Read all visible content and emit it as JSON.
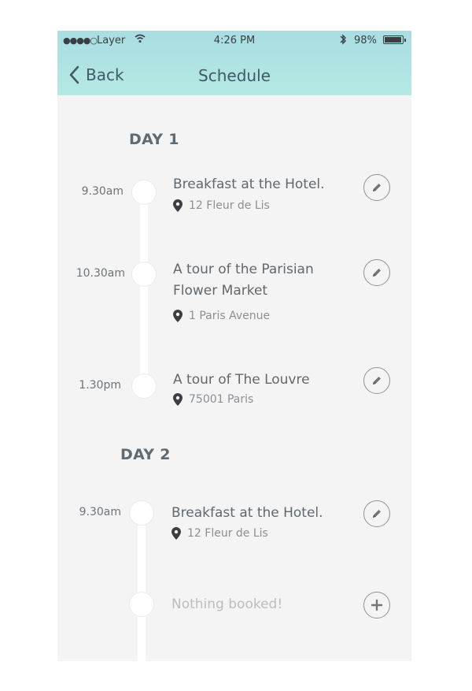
{
  "status_bar": {
    "carrier": "Layer",
    "time": "4:26 PM",
    "battery": "98%"
  },
  "nav": {
    "back_label": "Back",
    "title": "Schedule"
  },
  "days": [
    {
      "label": "DAY 1",
      "events": [
        {
          "time": "9.30am",
          "title": "Breakfast at the Hotel.",
          "location": "12 Fleur de Lis"
        },
        {
          "time": "10.30am",
          "title_line1": "A tour of the Parisian",
          "title_line2": "Flower Market",
          "location": "1 Paris Avenue"
        },
        {
          "time": "1.30pm",
          "title": "A tour of The Louvre",
          "location": "75001 Paris"
        }
      ]
    },
    {
      "label": "DAY 2",
      "events": [
        {
          "time": "9.30am",
          "title": "Breakfast at the Hotel.",
          "location": "12 Fleur de Lis"
        },
        {
          "placeholder": "Nothing booked!"
        }
      ]
    }
  ]
}
